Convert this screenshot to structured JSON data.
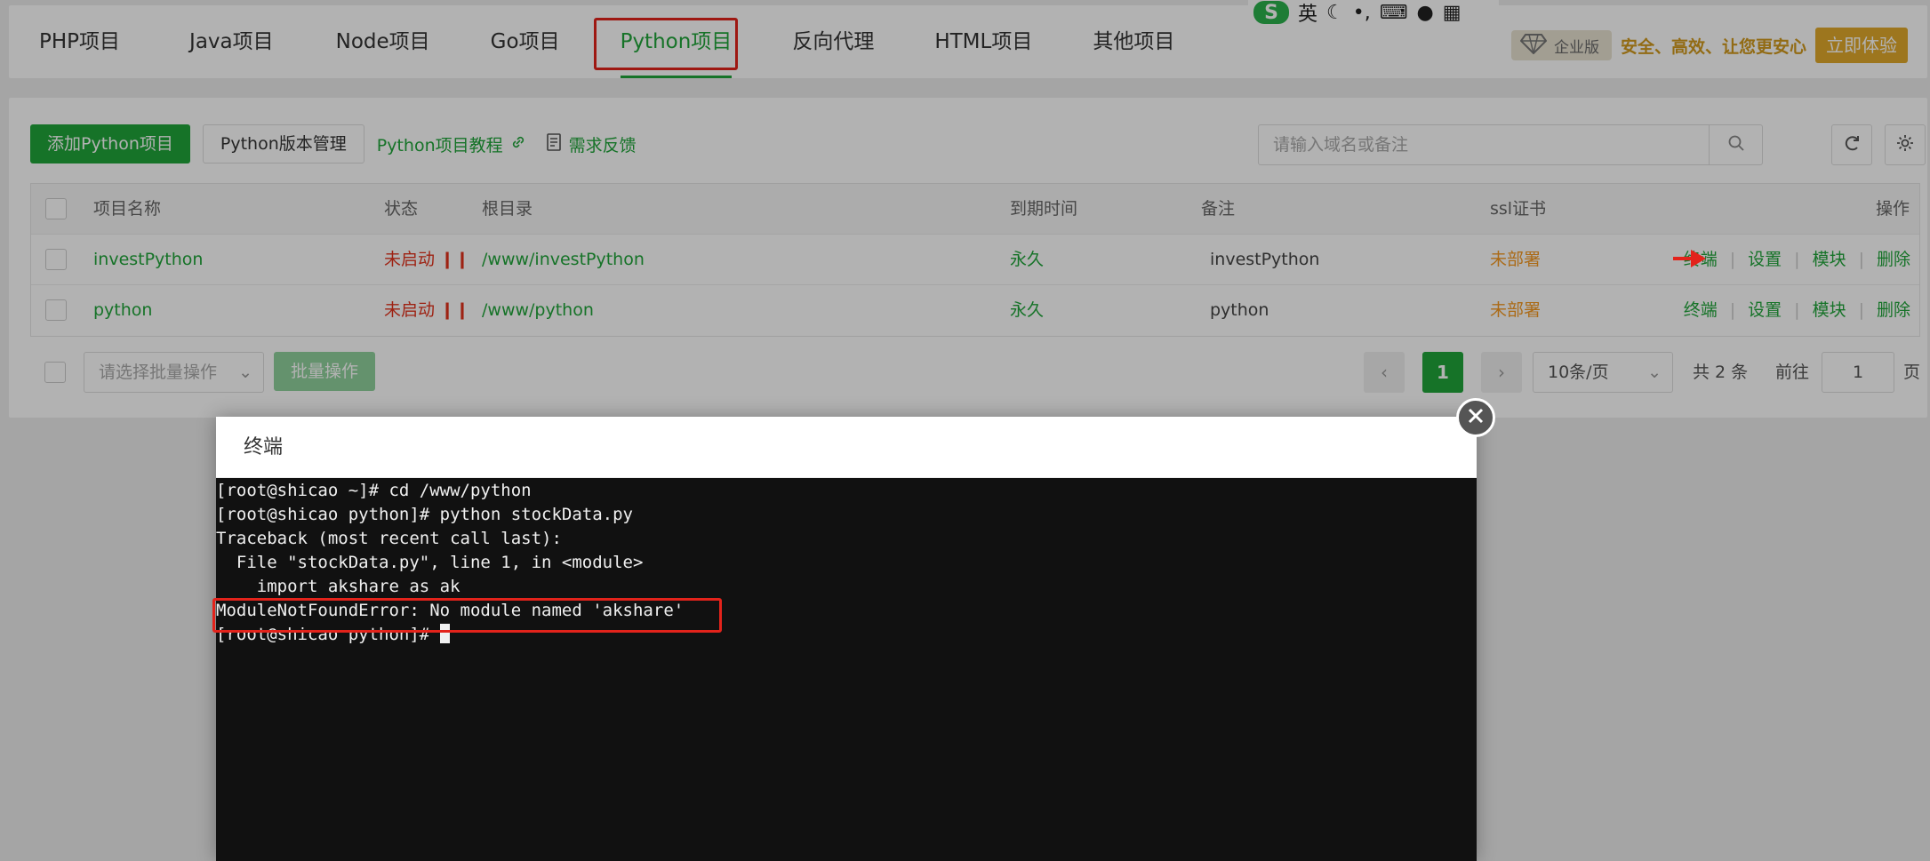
{
  "tabs": [
    {
      "label": "PHP项目",
      "active": false
    },
    {
      "label": "Java项目",
      "active": false
    },
    {
      "label": "Node项目",
      "active": false
    },
    {
      "label": "Go项目",
      "active": false
    },
    {
      "label": "Python项目",
      "active": true
    },
    {
      "label": "反向代理",
      "active": false
    },
    {
      "label": "HTML项目",
      "active": false
    },
    {
      "label": "其他项目",
      "active": false
    }
  ],
  "ime": {
    "lang": "英"
  },
  "promo": {
    "edition": "企业版",
    "slogan": "安全、高效、让您更安心",
    "trial": "立即体验"
  },
  "toolbar": {
    "add_label": "添加Python项目",
    "version_label": "Python版本管理",
    "tutorial_label": "Python项目教程",
    "feedback_label": "需求反馈",
    "search_placeholder": "请输入域名或备注"
  },
  "table": {
    "headers": {
      "name": "项目名称",
      "status": "状态",
      "root": "根目录",
      "expire": "到期时间",
      "note": "备注",
      "ssl": "ssl证书",
      "ops": "操作"
    },
    "rows": [
      {
        "name": "investPython",
        "status": "未启动",
        "root": "/www/investPython",
        "expire": "永久",
        "note": "investPython",
        "ssl": "未部署",
        "ops": [
          "终端",
          "设置",
          "模块",
          "删除"
        ]
      },
      {
        "name": "python",
        "status": "未启动",
        "root": "/www/python",
        "expire": "永久",
        "note": "python",
        "ssl": "未部署",
        "ops": [
          "终端",
          "设置",
          "模块",
          "删除"
        ]
      }
    ]
  },
  "footer": {
    "batch_placeholder": "请选择批量操作",
    "batch_button": "批量操作",
    "current_page": "1",
    "page_size": "10条/页",
    "total": "共 2 条",
    "goto_label": "前往",
    "goto_value": "1",
    "page_unit": "页"
  },
  "modal": {
    "title": "终端",
    "lines": [
      "[root@shicao ~]# cd /www/python",
      "[root@shicao python]# python stockData.py",
      "Traceback (most recent call last):",
      "  File \"stockData.py\", line 1, in <module>",
      "    import akshare as ak",
      "ModuleNotFoundError: No module named 'akshare'",
      "[root@shicao python]# "
    ]
  },
  "colors": {
    "accent": "#20a53a",
    "error": "#e3321c",
    "warning": "#f59a23",
    "highlight": "#e3231b"
  }
}
